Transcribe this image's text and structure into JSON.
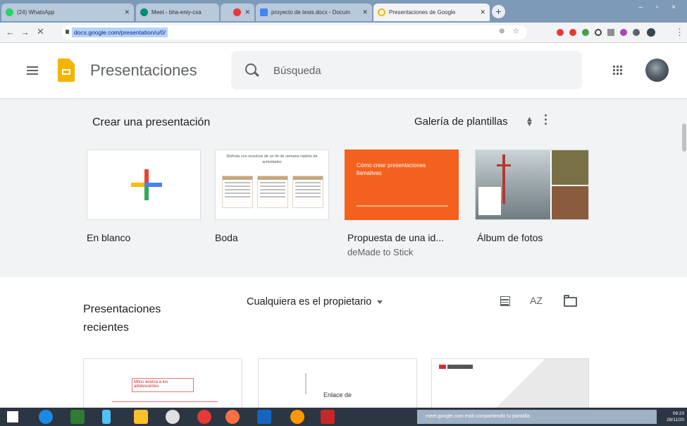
{
  "browser": {
    "tabs": [
      {
        "label": "(24) WhatsApp",
        "color": "#25d366"
      },
      {
        "label": "Meet - bha-eniy-cxa",
        "color": "#00897b"
      },
      {
        "label": "",
        "color": "#e53935"
      },
      {
        "label": "proyecto de tesis.docx - Docum",
        "color": "#4285f4"
      },
      {
        "label": "Presentaciones de Google",
        "color": "#f4b400"
      }
    ],
    "url": "docs.google.com/presentation/u/0/",
    "new_tab_symbol": "+",
    "window_controls": "– ▫ ×"
  },
  "header": {
    "app_name": "Presentaciones",
    "search_placeholder": "Búsqueda"
  },
  "gallery": {
    "title": "Crear una presentación",
    "link": "Galería de plantillas",
    "templates": [
      {
        "label": "En blanco",
        "sub": ""
      },
      {
        "label": "Boda",
        "sub": "",
        "preview_text": "Disfruta con nosotros de un fin de semana repleto de actividades"
      },
      {
        "label": "Propuesta de una id...",
        "sub": "deMade to Stick",
        "preview_text": "Cómo crear presentaciones llamativas"
      },
      {
        "label": "Álbum de fotos",
        "sub": ""
      }
    ]
  },
  "recent": {
    "title": "Presentaciones recientes",
    "owner_filter": "Cualquiera es el propietario",
    "sort_label": "AZ",
    "docs": [
      {
        "preview_text": "Mitos acerca a los adolescentes"
      },
      {
        "preview_text": "Enlace de"
      },
      {
        "preview_text": ""
      }
    ]
  },
  "taskbar": {
    "notification": "meet.google.com está compartiendo tu pantalla.",
    "time": "09:23",
    "date": "28/11/20"
  },
  "colors": {
    "slides_yellow": "#f4b400",
    "orange_template": "#f4611f",
    "gallery_bg": "#f1f3f4"
  }
}
